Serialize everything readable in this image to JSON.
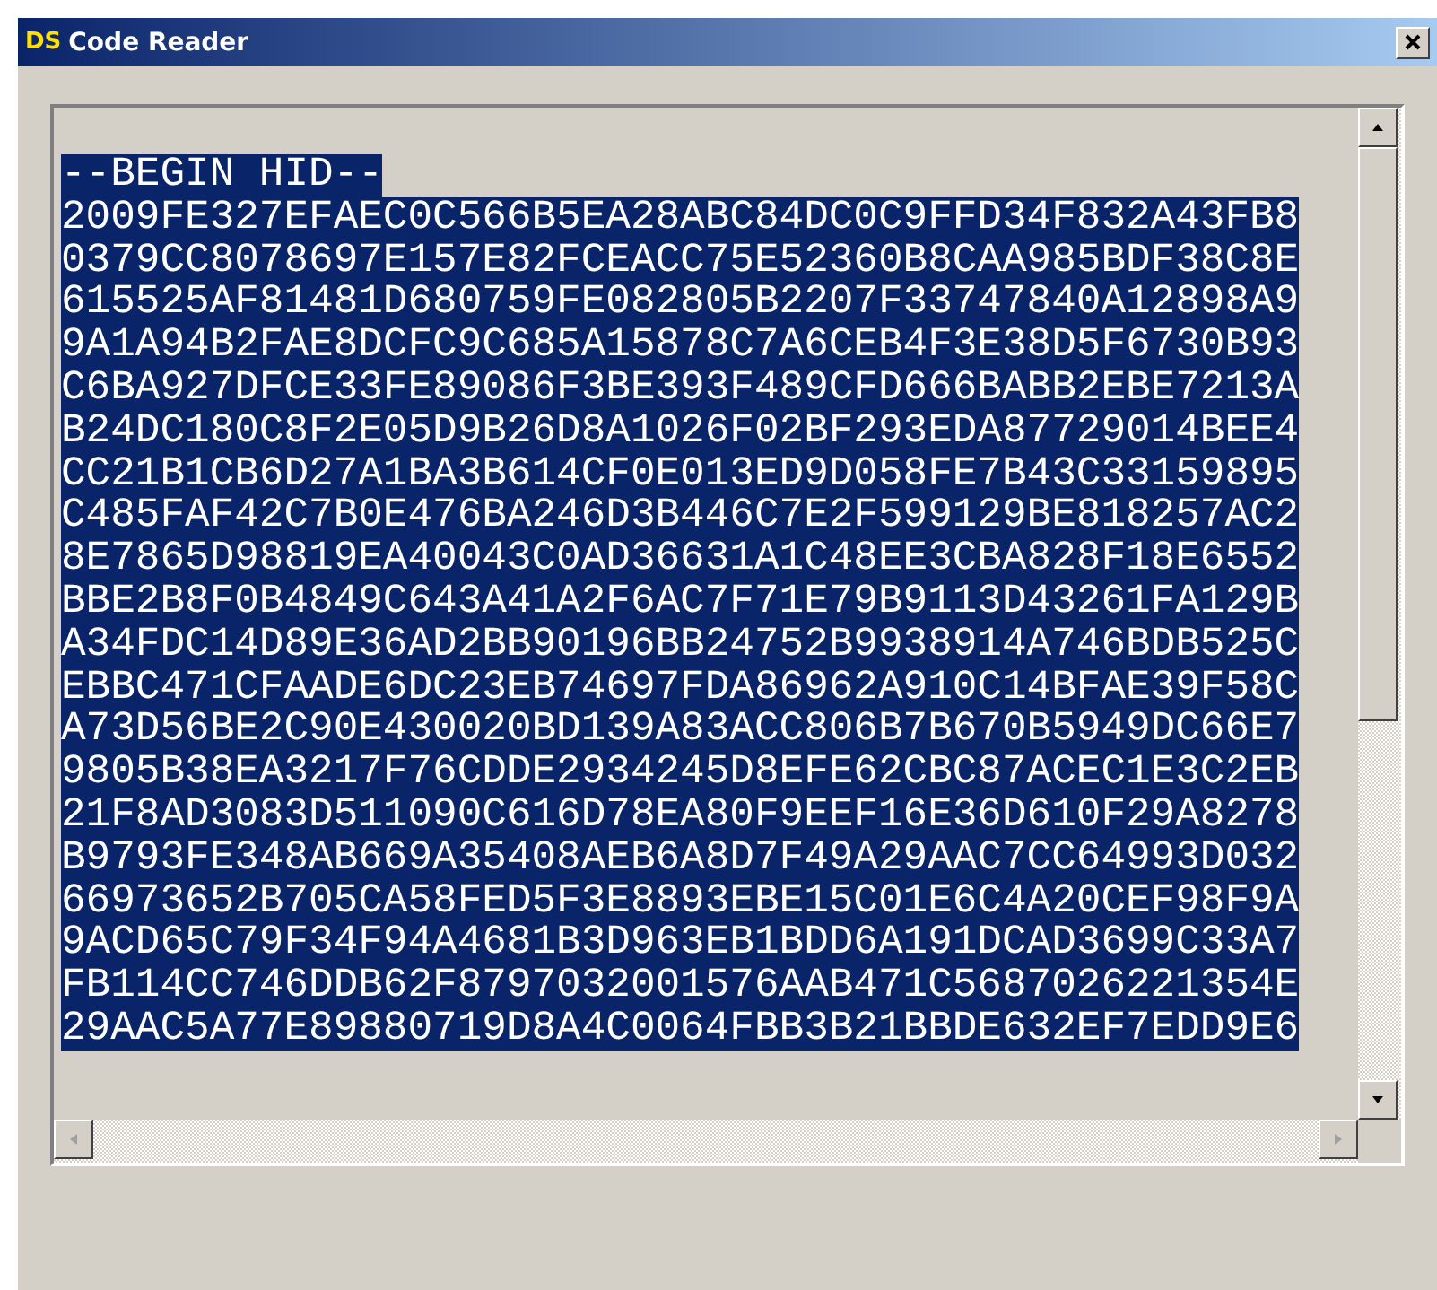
{
  "window": {
    "logo": "DS",
    "title": "Code Reader"
  },
  "text_area": {
    "selected": true,
    "lines": [
      "--BEGIN HID--",
      "2009FE327EFAEC0C566B5EA28ABC84DC0C9FFD34F832A43FB8",
      "0379CC8078697E157E82FCEACC75E52360B8CAA985BDF38C8E",
      "615525AF81481D680759FE082805B2207F33747840A12898A9",
      "9A1A94B2FAE8DCFC9C685A15878C7A6CEB4F3E38D5F6730B93",
      "C6BA927DFCE33FE89086F3BE393F489CFD666BABB2EBE7213A",
      "B24DC180C8F2E05D9B26D8A1026F02BF293EDA87729014BEE4",
      "CC21B1CB6D27A1BA3B614CF0E013ED9D058FE7B43C33159895",
      "C485FAF42C7B0E476BA246D3B446C7E2F599129BE818257AC2",
      "8E7865D98819EA40043C0AD36631A1C48EE3CBA828F18E6552",
      "BBE2B8F0B4849C643A41A2F6AC7F71E79B9113D43261FA129B",
      "A34FDC14D89E36AD2BB90196BB24752B9938914A746BDB525C",
      "EBBC471CFAADE6DC23EB74697FDA86962A910C14BFAE39F58C",
      "A73D56BE2C90E430020BD139A83ACC806B7B670B5949DC66E7",
      "9805B38EA3217F76CDDE2934245D8EFE62CBC87ACEC1E3C2EB",
      "21F8AD3083D511090C616D78EA80F9EEF16E36D610F29A8278",
      "B9793FE348AB669A35408AEB6A8D7F49A29AAC7CC64993D032",
      "66973652B705CA58FED5F3E8893EBE15C01E6C4A20CEF98F9A",
      "9ACD65C79F34F94A4681B3D963EB1BDD6A191DCAD3699C33A7",
      "FB114CC746DDB62F8797032001576AAB471C5687026221354E",
      "29AAC5A77E89880719D8A4C0064FBB3B21BBDE632EF7EDD9E6"
    ]
  }
}
